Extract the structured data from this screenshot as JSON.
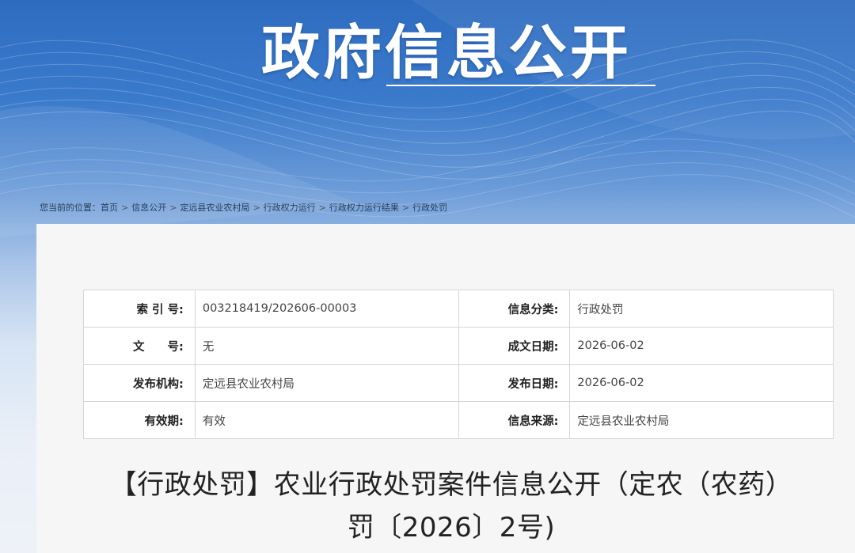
{
  "banner": {
    "title": "政府信息公开"
  },
  "breadcrumb": {
    "prefix": "您当前的位置：",
    "items": [
      "首页",
      "信息公开",
      "定远县农业农村局",
      "行政权力运行",
      "行政权力运行结果",
      "行政处罚"
    ],
    "separator": ">"
  },
  "meta": {
    "index_label": "索 引 号:",
    "index_value": "003218419/202606-00003",
    "category_label": "信息分类:",
    "category_value": "行政处罚",
    "docno_label": "文　　号:",
    "docno_value": "无",
    "created_label": "成文日期:",
    "created_value": "2026-06-02",
    "publisher_label": "发布机构:",
    "publisher_value": "定远县农业农村局",
    "published_label": "发布日期:",
    "published_value": "2026-06-02",
    "validity_label": "有效期:",
    "validity_value": "有效",
    "source_label": "信息来源:",
    "source_value": "定远县农业农村局"
  },
  "document": {
    "title_line1": "【行政处罚】农业行政处罚案件信息公开（定农（农药）",
    "title_line2": "罚〔2026〕2号)"
  },
  "colors": {
    "banner_blue": "#2e6cc0",
    "panel_bg": "#f6f6f6",
    "table_border": "#d6d6d6"
  }
}
